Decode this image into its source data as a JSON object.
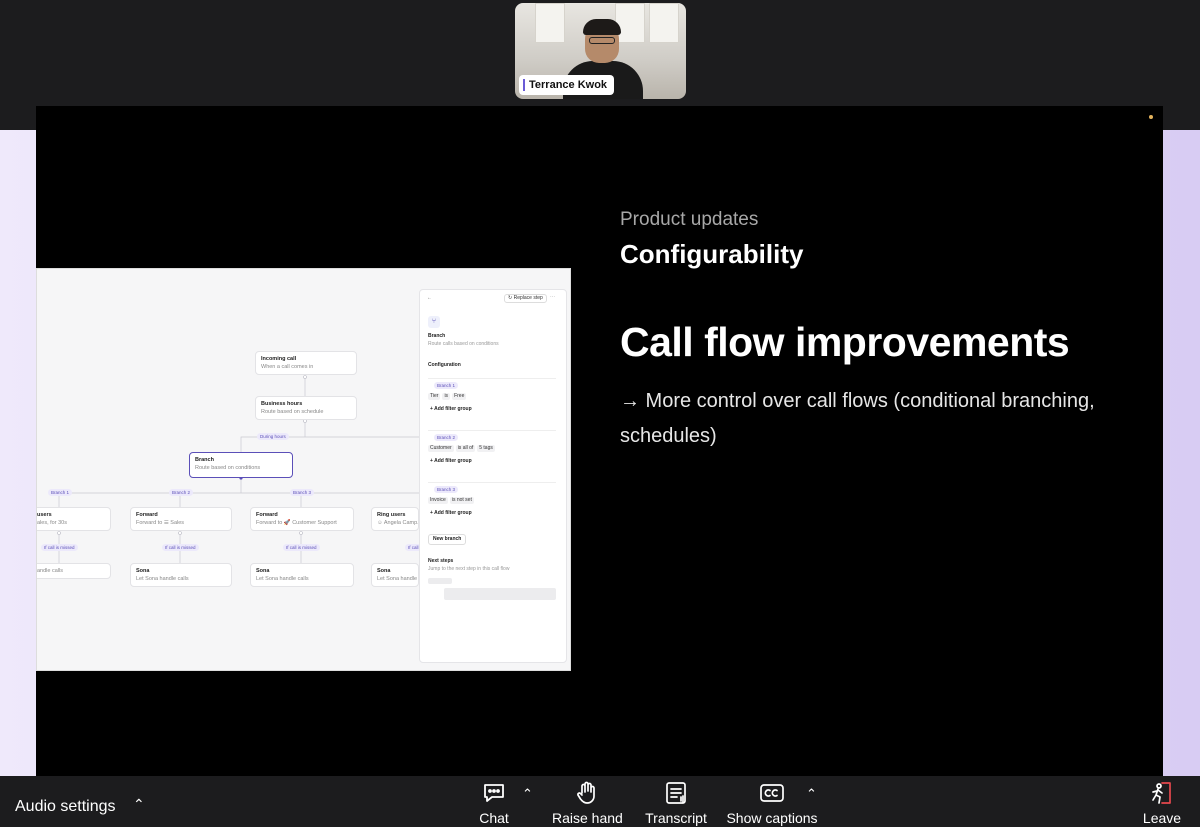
{
  "participant": {
    "name": "Terrance Kwok"
  },
  "slide": {
    "eyebrow": "Product updates",
    "section": "Configurability",
    "headline": "Call flow improvements",
    "bullet": "→ More control over call flows (conditional branching, schedules)"
  },
  "embed": {
    "nodes": {
      "incoming": {
        "title": "Incoming call",
        "sub": "When a call comes in"
      },
      "business": {
        "title": "Business hours",
        "sub": "Route based on schedule"
      },
      "branch": {
        "title": "Branch",
        "sub": "Route based on conditions"
      },
      "users": {
        "title": "users",
        "sub": "ales, for 30s"
      },
      "forward1": {
        "title": "Forward",
        "sub": "Forward to ☰ Sales"
      },
      "forward2": {
        "title": "Forward",
        "sub": "Forward to 🚀 Customer Support"
      },
      "ring": {
        "title": "Ring users",
        "sub": "☺ Angela Camp..."
      },
      "sona0": {
        "title": "",
        "sub": "andle calls"
      },
      "sona1": {
        "title": "Sona",
        "sub": "Let Sona handle calls"
      },
      "sona2": {
        "title": "Sona",
        "sub": "Let Sona handle calls"
      },
      "sona3": {
        "title": "Sona",
        "sub": "Let Sona handle calls"
      }
    },
    "pills": {
      "during_hours": "During hours",
      "branch1": "Branch 1",
      "branch2": "Branch 2",
      "branch3": "Branch 3",
      "missed": "If call is missed",
      "missed_short": "If call"
    },
    "panel": {
      "back": "←",
      "replace": "↻ Replace step",
      "more": "···",
      "title": "Branch",
      "sub": "Route calls based on conditions",
      "config": "Configuration",
      "b1": {
        "label": "Branch 1",
        "f1": "Tier",
        "f2": "is",
        "f3": "Free",
        "add": "+ Add filter group"
      },
      "b2": {
        "label": "Branch 2",
        "f1": "Customer",
        "f2": "is all of",
        "f3": "5 tags",
        "add": "+ Add filter group"
      },
      "b3": {
        "label": "Branch 3",
        "f1": "Invoice",
        "f2": "is not set",
        "add": "+ Add filter group"
      },
      "new_branch": "New branch",
      "next_steps": "Next steps",
      "next_sub": "Jump to the next step in this call flow"
    }
  },
  "controls": {
    "audio": "Audio settings",
    "chat": "Chat",
    "raise": "Raise hand",
    "transcript": "Transcript",
    "captions": "Show captions",
    "leave": "Leave"
  },
  "colors": {
    "accent": "#5b4fb8",
    "backdrop": "#d8ccf3",
    "leave": "#e5484d"
  }
}
